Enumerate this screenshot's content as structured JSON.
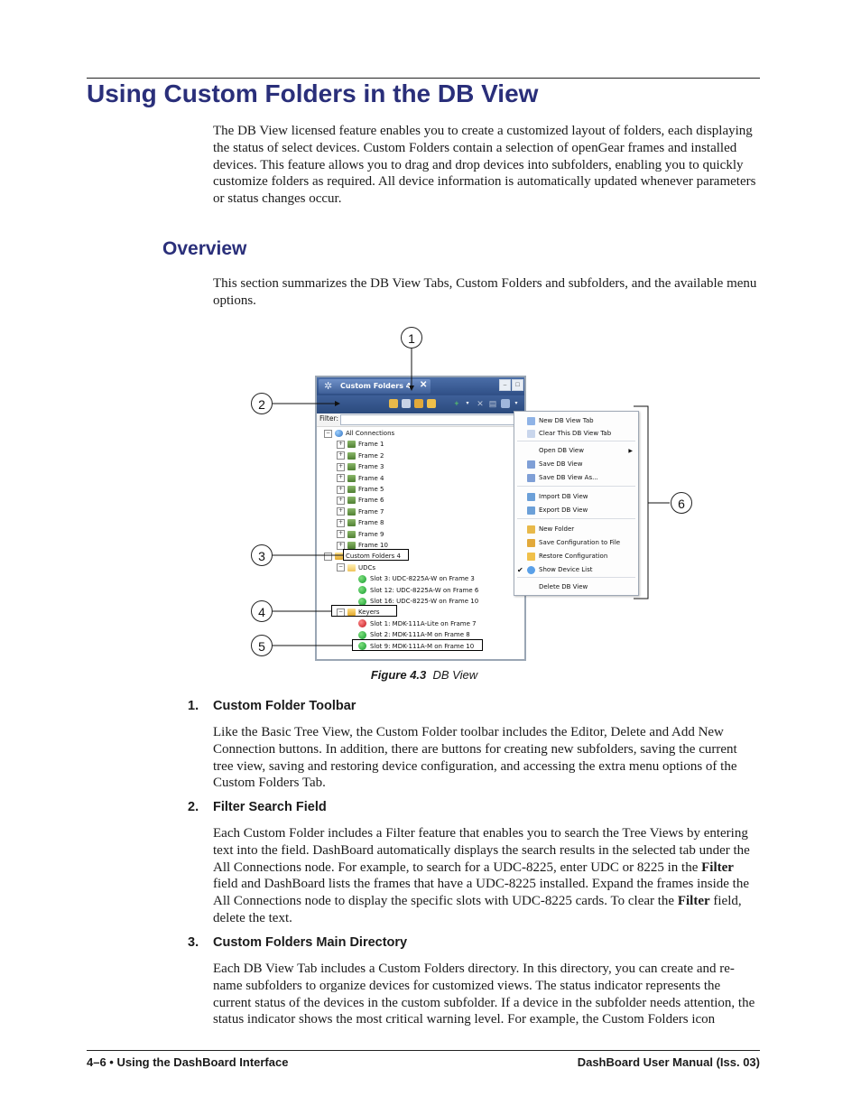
{
  "header": {
    "title": "Using Custom Folders in the DB View"
  },
  "intro": "The DB View licensed feature enables you to create a customized layout of folders, each displaying the status of select devices. Custom Folders contain a selection of openGear frames and installed devices. This feature allows you to drag and drop devices into subfolders, enabling you to quickly customize folders as required. All device information is automatically updated whenever parameters or status changes occur.",
  "overview": {
    "heading": "Overview",
    "text": "This section summarizes the DB View Tabs, Custom Folders and subfolders, and the available menu options."
  },
  "figure": {
    "caption_label": "Figure 4.3",
    "caption_title": "DB View",
    "tab_title": "Custom Folders 4",
    "filter_label": "Filter:",
    "tree": [
      {
        "label": "All Connections",
        "level": 0,
        "icon": "globe-icon",
        "expander": "−"
      },
      {
        "label": "Frame 1",
        "level": 1,
        "icon": "frame-icon",
        "expander": "+"
      },
      {
        "label": "Frame 2",
        "level": 1,
        "icon": "frame-icon",
        "expander": "+"
      },
      {
        "label": "Frame 3",
        "level": 1,
        "icon": "frame-icon",
        "expander": "+"
      },
      {
        "label": "Frame 4",
        "level": 1,
        "icon": "frame-icon",
        "expander": "+"
      },
      {
        "label": "Frame 5",
        "level": 1,
        "icon": "frame-icon",
        "expander": "+"
      },
      {
        "label": "Frame 6",
        "level": 1,
        "icon": "frame-icon",
        "expander": "+"
      },
      {
        "label": "Frame 7",
        "level": 1,
        "icon": "frame-icon",
        "expander": "+"
      },
      {
        "label": "Frame 8",
        "level": 1,
        "icon": "frame-icon",
        "expander": "+"
      },
      {
        "label": "Frame 9",
        "level": 1,
        "icon": "frame-icon",
        "expander": "+"
      },
      {
        "label": "Frame 10",
        "level": 1,
        "icon": "frame-icon",
        "expander": "+"
      },
      {
        "label": "Custom Folders 4",
        "level": 0,
        "icon": "folder-icon",
        "expander": "−"
      },
      {
        "label": "UDCs",
        "level": 1,
        "icon": "folder-open-icon",
        "expander": "−"
      },
      {
        "label": "Slot 3: UDC-8225A-W on Frame 3",
        "level": 2,
        "icon": "green-status-icon",
        "expander": ""
      },
      {
        "label": "Slot 12: UDC-8225A-W on Frame 6",
        "level": 2,
        "icon": "green-status-icon",
        "expander": ""
      },
      {
        "label": "Slot 16: UDC-8225-W on Frame 10",
        "level": 2,
        "icon": "green-status-icon",
        "expander": ""
      },
      {
        "label": "Keyers",
        "level": 1,
        "icon": "folder-icon",
        "expander": "−"
      },
      {
        "label": "Slot 1: MDK-111A-Lite on Frame 7",
        "level": 2,
        "icon": "red-status-icon",
        "expander": ""
      },
      {
        "label": "Slot 2: MDK-111A-M on Frame 8",
        "level": 2,
        "icon": "green-status-icon",
        "expander": ""
      },
      {
        "label": "Slot 9: MDK-111A-M on Frame 10",
        "level": 2,
        "icon": "green-status-icon",
        "expander": ""
      }
    ],
    "menu": [
      {
        "label": "New DB View Tab",
        "icon": "new-tab-icon"
      },
      {
        "label": "Clear This DB View Tab",
        "icon": "clear-icon"
      },
      {
        "label": "Open DB View",
        "icon": "",
        "submenu": true
      },
      {
        "label": "Save DB View",
        "icon": "save-icon"
      },
      {
        "label": "Save DB View As...",
        "icon": "save-as-icon"
      },
      {
        "label": "Import DB View",
        "icon": "import-icon"
      },
      {
        "label": "Export DB View",
        "icon": "export-icon"
      },
      {
        "label": "New Folder",
        "icon": "new-folder-icon"
      },
      {
        "label": "Save Configuration to File",
        "icon": "save-config-icon"
      },
      {
        "label": "Restore Configuration",
        "icon": "restore-icon"
      },
      {
        "label": "Show Device List",
        "icon": "device-list-icon",
        "checked": true
      },
      {
        "label": "Delete DB View",
        "icon": ""
      }
    ],
    "callouts": [
      "1",
      "2",
      "3",
      "4",
      "5",
      "6"
    ]
  },
  "sections": [
    {
      "number": "1.",
      "title": "Custom Folder Toolbar",
      "body": "Like the Basic Tree View, the Custom Folder toolbar includes the Editor, Delete and Add New Connection buttons. In addition, there are buttons for creating new subfolders, saving the current tree view, saving and restoring device configuration, and accessing the extra menu options of the Custom Folders Tab."
    },
    {
      "number": "2.",
      "title": "Filter Search Field",
      "body_parts": [
        "Each Custom Folder includes a Filter feature that enables you to search the Tree Views by entering text into the field. DashBoard automatically displays the search results in the selected tab under the All Connections node. For example, to search for a UDC-8225, enter UDC or 8225 in the ",
        "Filter",
        " field and DashBoard lists the frames that have a UDC-8225 installed. Expand the frames inside the All Connections node to display the specific slots with UDC-8225 cards. To clear the ",
        "Filter",
        " field, delete the text."
      ]
    },
    {
      "number": "3.",
      "title": "Custom Folders Main Directory",
      "body": "Each DB View Tab includes a Custom Folders directory. In this directory, you can create and re-name subfolders to organize devices for customized views. The status indicator represents the current status of the devices in the custom subfolder. If a device in the subfolder needs attention, the status indicator shows the most critical warning level. For example, the Custom Folders icon"
    }
  ],
  "footer": {
    "left": "4–6 • Using the DashBoard Interface",
    "right": "DashBoard User Manual (Iss. 03)"
  }
}
